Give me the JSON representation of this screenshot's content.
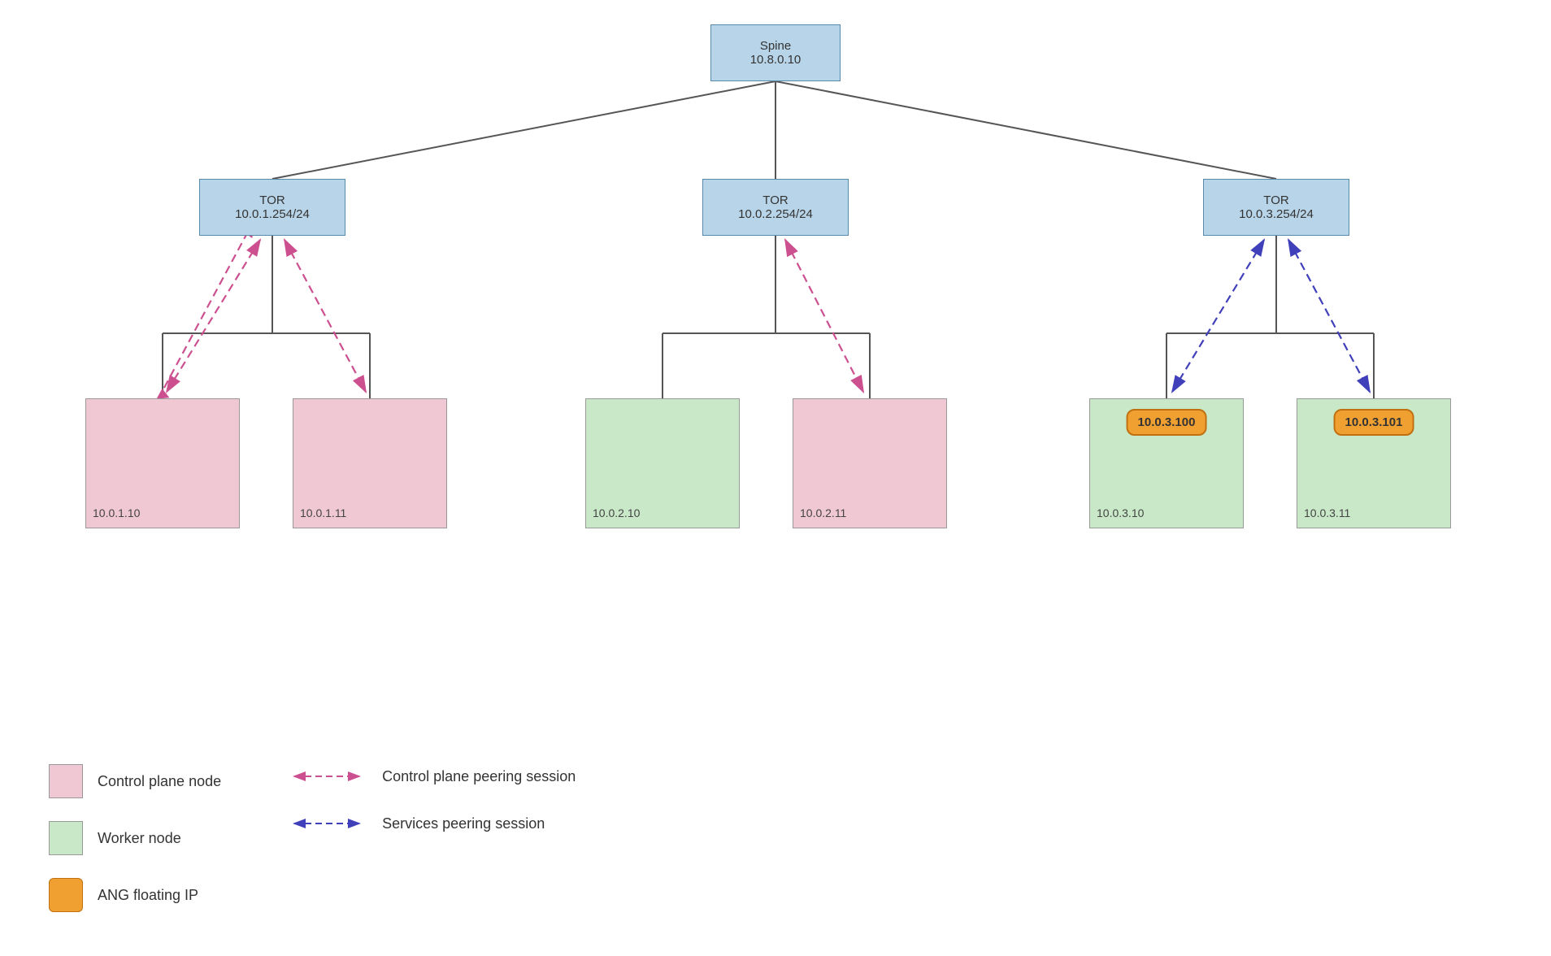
{
  "diagram": {
    "spine": {
      "label": "Spine",
      "ip": "10.8.0.10"
    },
    "tor1": {
      "label": "TOR",
      "ip": "10.0.1.254/24"
    },
    "tor2": {
      "label": "TOR",
      "ip": "10.0.2.254/24"
    },
    "tor3": {
      "label": "TOR",
      "ip": "10.0.3.254/24"
    },
    "servers": [
      {
        "id": "s1",
        "ip": "10.0.1.10",
        "type": "cp"
      },
      {
        "id": "s2",
        "ip": "10.0.1.11",
        "type": "cp"
      },
      {
        "id": "s3",
        "ip": "10.0.2.10",
        "type": "worker"
      },
      {
        "id": "s4",
        "ip": "10.0.2.11",
        "type": "cp"
      },
      {
        "id": "s5",
        "ip": "10.0.3.10",
        "type": "worker",
        "floating_ip": "10.0.3.100"
      },
      {
        "id": "s6",
        "ip": "10.0.3.11",
        "type": "worker",
        "floating_ip": "10.0.3.101"
      }
    ]
  },
  "legend": {
    "control_plane_label": "Control plane node",
    "worker_label": "Worker node",
    "floating_ip_label": "ANG floating IP",
    "cp_peering_label": "Control plane peering session",
    "services_peering_label": "Services peering session"
  }
}
